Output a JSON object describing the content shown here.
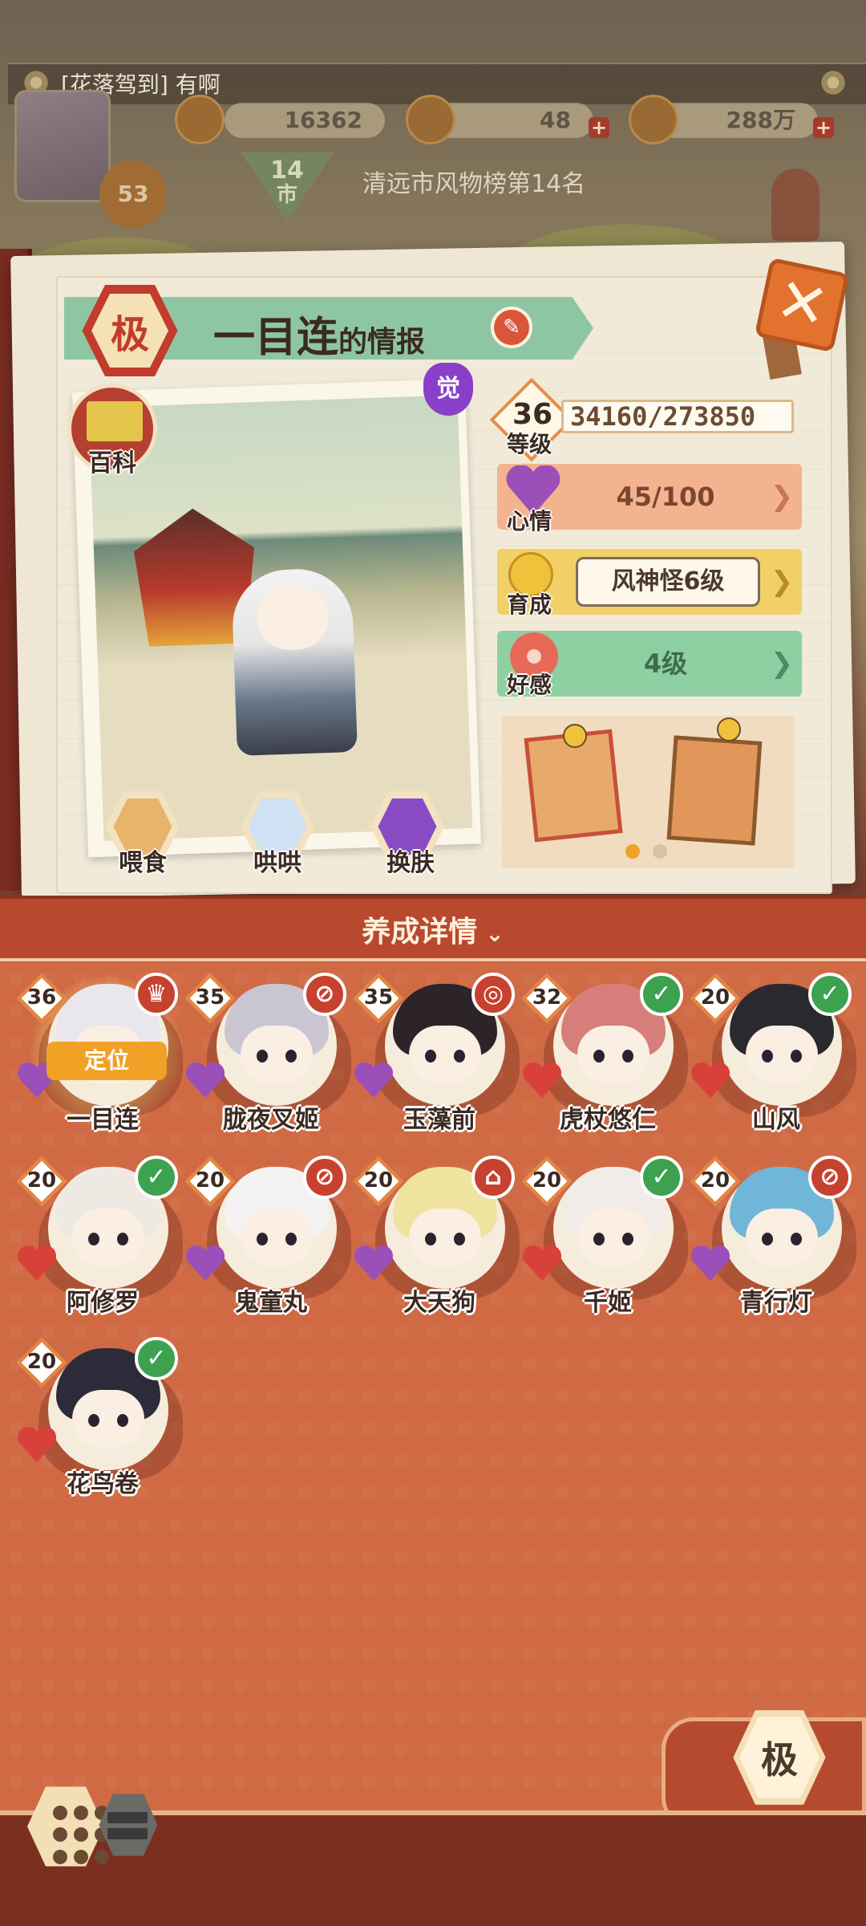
{
  "top_hud": {
    "chat_message": "[花落驾到] 有啊",
    "player_level": "53",
    "resource_1": "16362",
    "resource_2": "48",
    "resource_3": "288万",
    "plus_symbol": "+",
    "city_rank_number": "14",
    "city_rank_unit": "市",
    "city_rank_text": "清远市风物榜第14名"
  },
  "info_panel": {
    "rank_badge": "极",
    "title_name": "一目连",
    "title_suffix": "的情报",
    "awakened_badge": "觉",
    "wiki_label": "百科",
    "close_symbol": "✕",
    "actions": [
      {
        "label": "喂食",
        "icon": "noodle-bowl-icon"
      },
      {
        "label": "哄哄",
        "icon": "milk-carton-icon"
      },
      {
        "label": "换肤",
        "icon": "skin-change-icon"
      }
    ],
    "level": {
      "value": "36",
      "label": "等级",
      "exp": "34160/273850"
    },
    "mood": {
      "label": "心情",
      "value": "45/100"
    },
    "growth": {
      "label": "育成",
      "value": "风神怪6级"
    },
    "affection": {
      "label": "好感",
      "value": "4级"
    },
    "chevron": "❯",
    "gift_pages": 2,
    "gift_active_page": 1
  },
  "detail_toggle": {
    "label": "养成详情",
    "chevron": "⌄"
  },
  "characters": [
    {
      "name": "一目连",
      "level": "36",
      "status": "hat",
      "mood": "purple",
      "hair": "#e9e6ec",
      "selected": true,
      "locate_label": "定位"
    },
    {
      "name": "胧夜叉姬",
      "level": "35",
      "status": "no",
      "mood": "purple",
      "hair": "#c9c6d2"
    },
    {
      "name": "玉藻前",
      "level": "35",
      "status": "face",
      "mood": "purple",
      "hair": "#2c2428"
    },
    {
      "name": "虎杖悠仁",
      "level": "32",
      "status": "check",
      "mood": "red",
      "hair": "#d67f7a"
    },
    {
      "name": "山风",
      "level": "20",
      "status": "check",
      "mood": "red",
      "hair": "#2a2a2e"
    },
    {
      "name": "阿修罗",
      "level": "20",
      "status": "check",
      "mood": "red",
      "hair": "#efe9e4"
    },
    {
      "name": "鬼童丸",
      "level": "20",
      "status": "no",
      "mood": "purple",
      "hair": "#f4f2f2"
    },
    {
      "name": "大天狗",
      "level": "20",
      "status": "bell",
      "mood": "purple",
      "hair": "#eee4a0"
    },
    {
      "name": "千姬",
      "level": "20",
      "status": "check",
      "mood": "red",
      "hair": "#f2ece8"
    },
    {
      "name": "青行灯",
      "level": "20",
      "status": "no",
      "mood": "purple",
      "hair": "#6fb6d8"
    },
    {
      "name": "花鸟卷",
      "level": "20",
      "status": "check",
      "mood": "red",
      "hair": "#2d2b3a"
    }
  ],
  "footer": {
    "rank_filter": "极"
  },
  "colors": {
    "check": "#3da24f",
    "status_red": "#c7412f",
    "mood_purple": "#9b4fb8",
    "mood_red": "#d8413a",
    "panel_bg": "#cf6a44"
  }
}
